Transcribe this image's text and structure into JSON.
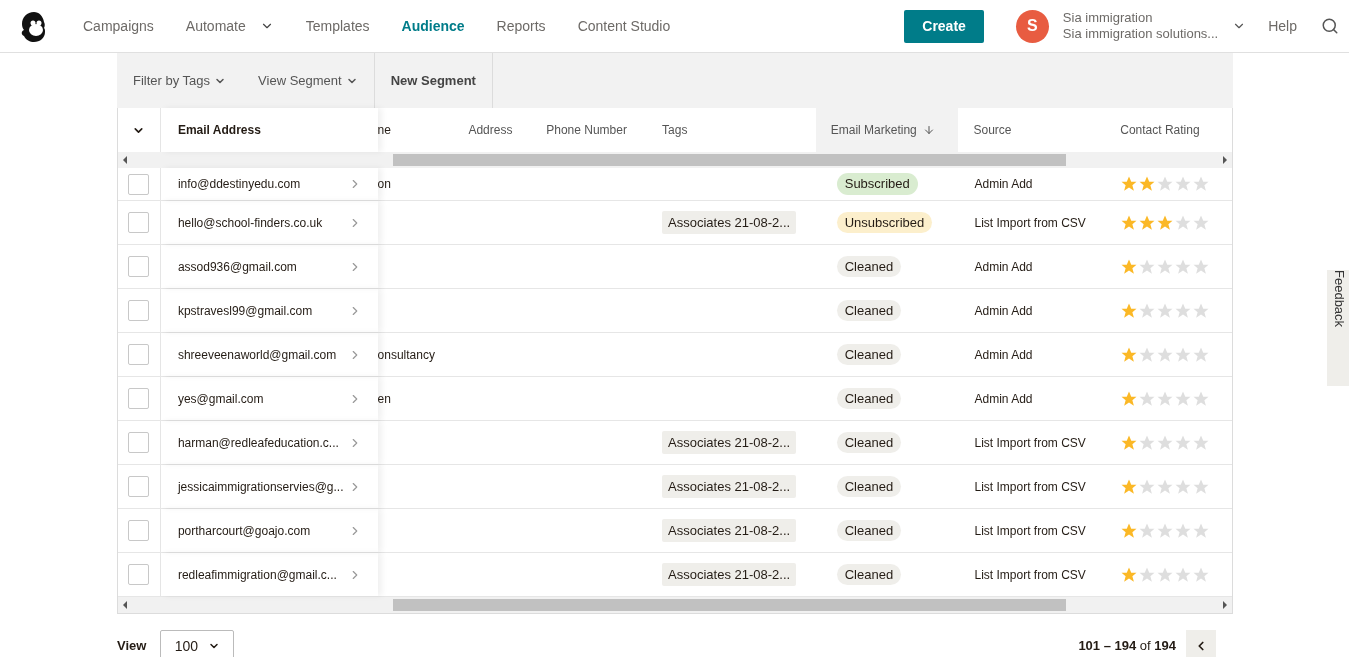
{
  "nav": {
    "items": [
      {
        "label": "Campaigns",
        "selected": false,
        "has_menu": false
      },
      {
        "label": "Automate",
        "selected": false,
        "has_menu": true
      },
      {
        "label": "Templates",
        "selected": false,
        "has_menu": false
      },
      {
        "label": "Audience",
        "selected": true,
        "has_menu": false
      },
      {
        "label": "Reports",
        "selected": false,
        "has_menu": false
      },
      {
        "label": "Content Studio",
        "selected": false,
        "has_menu": false
      }
    ],
    "create_button": "Create",
    "account": {
      "initial": "S",
      "name": "Sia immigration",
      "org": "Sia immigration solutions..."
    },
    "help": "Help"
  },
  "toolbar": {
    "filters": [
      "Filter by Tags",
      "View Segment"
    ],
    "new_segment": "New Segment"
  },
  "table": {
    "columns": [
      {
        "label": "Email Address",
        "sorted": false
      },
      {
        "label": "ne",
        "sorted": false
      },
      {
        "label": "Address",
        "sorted": false
      },
      {
        "label": "Phone Number",
        "sorted": false
      },
      {
        "label": "Tags",
        "sorted": false
      },
      {
        "label": "Email Marketing",
        "sorted": true
      },
      {
        "label": "Source",
        "sorted": false
      },
      {
        "label": "Contact Rating",
        "sorted": false
      }
    ],
    "rows": [
      {
        "checked": false,
        "email": "info@ddestinyedu.com",
        "column_2": "on",
        "tag": "",
        "status": {
          "label": "Subscribed",
          "color": "#d9ecd0"
        },
        "source": "Admin Add",
        "stars": 2
      },
      {
        "checked": false,
        "email": "hello@school-finders.co.uk",
        "column_2": "",
        "tag": "Associates 21-08-2...",
        "status": {
          "label": "Unsubscribed",
          "color": "#fcefcc"
        },
        "source": "List Import from CSV",
        "stars": 3
      },
      {
        "checked": false,
        "email": "assod936@gmail.com",
        "column_2": "",
        "tag": "",
        "status": {
          "label": "Cleaned",
          "color": "#efeeea"
        },
        "source": "Admin Add",
        "stars": 1
      },
      {
        "checked": false,
        "email": "kpstravesl99@gmail.com",
        "column_2": "",
        "tag": "",
        "status": {
          "label": "Cleaned",
          "color": "#efeeea"
        },
        "source": "Admin Add",
        "stars": 1
      },
      {
        "checked": false,
        "email": "shreeveenaworld@gmail.com",
        "column_2": "onsultancy",
        "tag": "",
        "status": {
          "label": "Cleaned",
          "color": "#efeeea"
        },
        "source": "Admin Add",
        "stars": 1
      },
      {
        "checked": false,
        "email": "yes@gmail.com",
        "column_2": "en",
        "tag": "",
        "status": {
          "label": "Cleaned",
          "color": "#efeeea"
        },
        "source": "Admin Add",
        "stars": 1
      },
      {
        "checked": false,
        "email": "harman@redleafeducation.c...",
        "column_2": "",
        "tag": "Associates 21-08-2...",
        "status": {
          "label": "Cleaned",
          "color": "#efeeea"
        },
        "source": "List Import from CSV",
        "stars": 1
      },
      {
        "checked": false,
        "email": "jessicaimmigrationservies@g...",
        "column_2": "",
        "tag": "Associates 21-08-2...",
        "status": {
          "label": "Cleaned",
          "color": "#efeeea"
        },
        "source": "List Import from CSV",
        "stars": 1
      },
      {
        "checked": false,
        "email": "portharcourt@goajo.com",
        "column_2": "",
        "tag": "Associates 21-08-2...",
        "status": {
          "label": "Cleaned",
          "color": "#efeeea"
        },
        "source": "List Import from CSV",
        "stars": 1
      },
      {
        "checked": false,
        "email": "redleafimmigration@gmail.c...",
        "column_2": "",
        "tag": "Associates 21-08-2...",
        "status": {
          "label": "Cleaned",
          "color": "#efeeea"
        },
        "source": "List Import from CSV",
        "stars": 1
      }
    ]
  },
  "footer": {
    "view_label": "View",
    "page_size": "100",
    "range": "**101 – 194** of **194**"
  },
  "feedback": "Feedback"
}
